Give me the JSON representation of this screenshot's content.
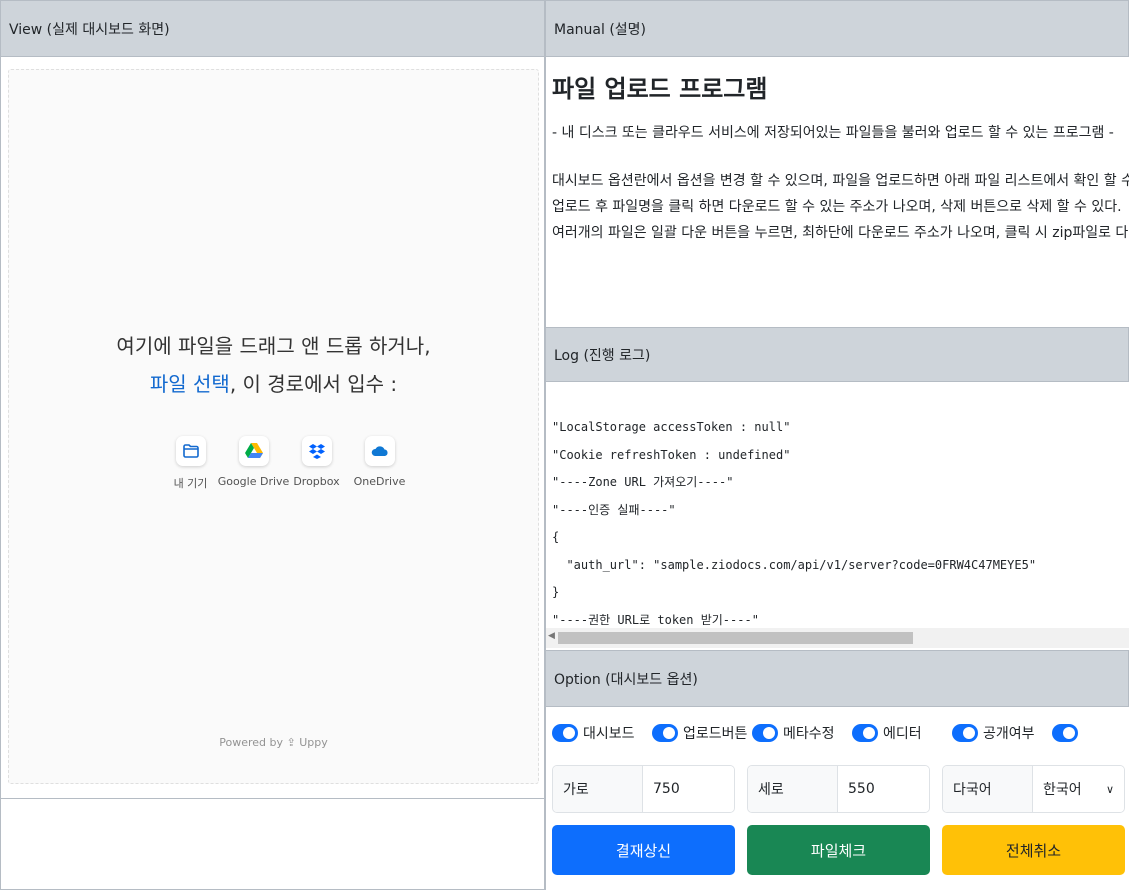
{
  "view": {
    "header": "View (실제 대시보드 화면)",
    "drop_line1": "여기에 파일을 드래그 앤 드롭 하거나,",
    "browse_text": "파일 선택",
    "drop_line2_rest": ", 이 경로에서 입수 :",
    "sources": [
      {
        "label": "내 기기",
        "icon": "folder-icon"
      },
      {
        "label": "Google Drive",
        "icon": "google-drive-icon"
      },
      {
        "label": "Dropbox",
        "icon": "dropbox-icon"
      },
      {
        "label": "OneDrive",
        "icon": "onedrive-icon"
      }
    ],
    "powered_by": "Powered by ⇪ Uppy"
  },
  "manual": {
    "header": "Manual (설명)",
    "title": "파일 업로드 프로그램",
    "subtitle": "- 내 디스크 또는 클라우드 서비스에 저장되어있는 파일들을 불러와 업로드 할 수 있는 프로그램 -",
    "lines": [
      "대시보드 옵션란에서 옵션을 변경 할 수 있으며, 파일을 업로드하면 아래 파일 리스트에서 확인 할 수 있다.",
      "업로드 후 파일명을 클릭 하면 다운로드 할 수 있는 주소가 나오며, 삭제 버튼으로 삭제 할 수 있다.",
      "여러개의 파일은 일괄 다운 버튼을 누르면, 최하단에 다운로드 주소가 나오며, 클릭 시 zip파일로 다운받을 수 있"
    ]
  },
  "log": {
    "header": "Log (진행 로그)",
    "lines": [
      "\"LocalStorage accessToken : null\"",
      "\"Cookie refreshToken : undefined\"",
      "\"----Zone URL 가져오기----\"",
      "\"----인증 실패----\"",
      "{",
      "  \"auth_url\": \"sample.ziodocs.com/api/v1/server?code=0FRW4C47MEYE5\"",
      "}",
      "\"----권한 URL로 token 받기----\""
    ]
  },
  "option": {
    "header": "Option (대시보드 옵션)",
    "toggles": [
      {
        "label": "대시보드",
        "on": true
      },
      {
        "label": "업로드버튼",
        "on": true
      },
      {
        "label": "메타수정",
        "on": true
      },
      {
        "label": "에디터",
        "on": true
      },
      {
        "label": "공개여부",
        "on": true
      },
      {
        "label": "",
        "on": true
      }
    ],
    "width": {
      "label": "가로",
      "value": "750"
    },
    "height": {
      "label": "세로",
      "value": "550"
    },
    "language": {
      "label": "다국어",
      "value": "한국어"
    },
    "buttons": {
      "approve": "결재상신",
      "check": "파일체크",
      "cancel": "전체취소"
    }
  },
  "colors": {
    "primary": "#0d6efd",
    "success": "#198754",
    "warning": "#ffc107",
    "header_bg": "#ced4da"
  }
}
